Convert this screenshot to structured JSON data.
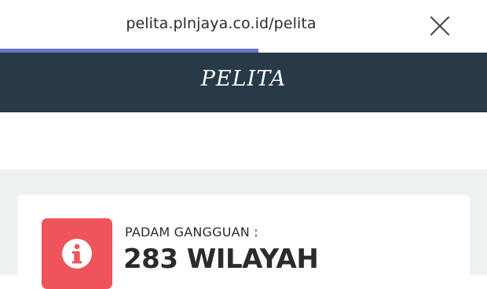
{
  "browser": {
    "url": "pelita.plnjaya.co.id/pelita",
    "close_icon": "close-icon",
    "load_progress": 0.53,
    "progress_color": "#6b73c9"
  },
  "header": {
    "brand": "PELITA",
    "background": "#283947"
  },
  "status_card": {
    "icon": "info-icon",
    "icon_bg": "#ef545a",
    "label": "PADAM GANGGUAN :",
    "value": "283 WILAYAH"
  }
}
